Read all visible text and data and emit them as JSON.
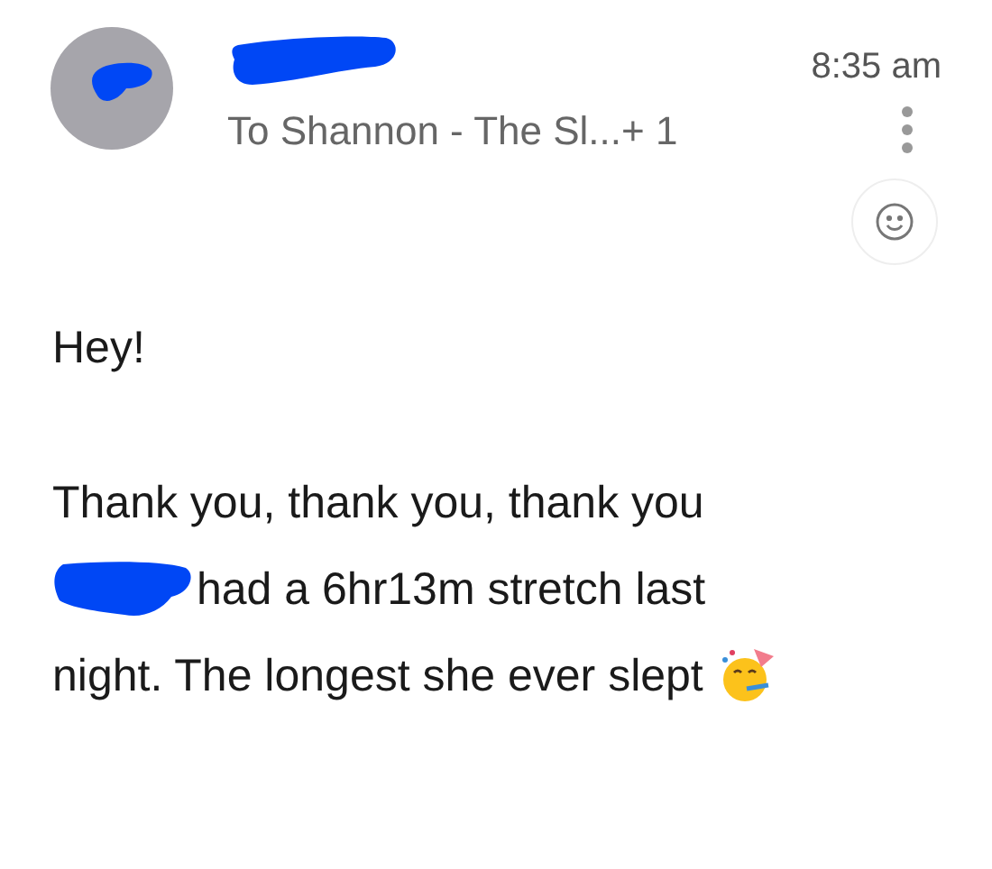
{
  "header": {
    "recipients": "To Shannon - The Sl...+ 1",
    "time": "8:35 am"
  },
  "body": {
    "greeting": "Hey!",
    "lines": [
      "Thank you, thank you, thank you",
      "had a 6hr13m stretch last",
      "night. The longest she ever slept"
    ]
  }
}
